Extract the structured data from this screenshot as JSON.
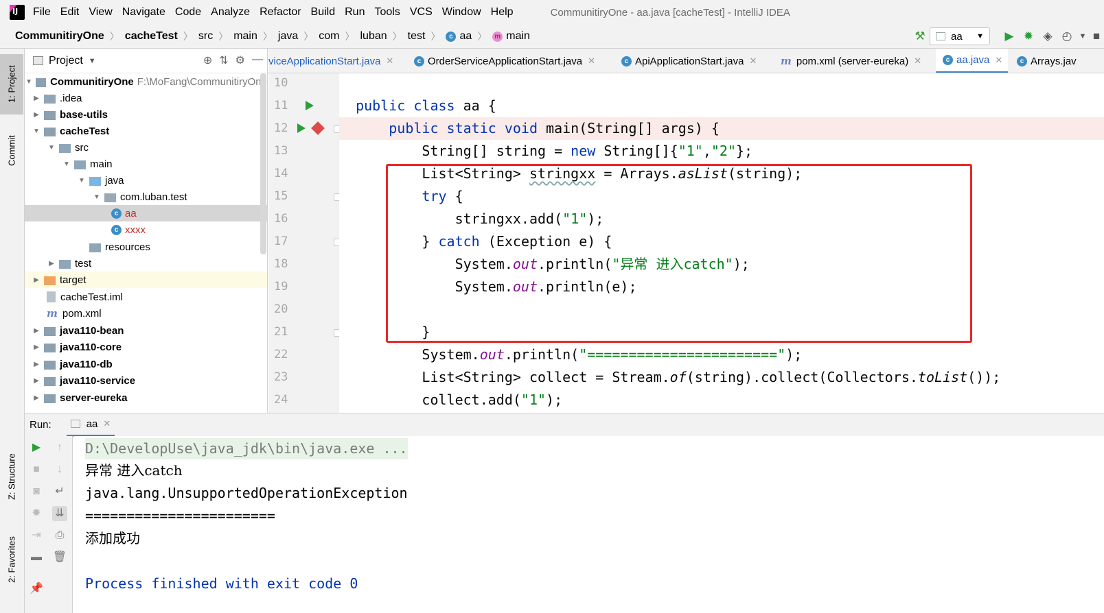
{
  "menubar": {
    "items": [
      "File",
      "Edit",
      "View",
      "Navigate",
      "Code",
      "Analyze",
      "Refactor",
      "Build",
      "Run",
      "Tools",
      "VCS",
      "Window",
      "Help"
    ],
    "title": "CommunitiryOne - aa.java [cacheTest] - IntelliJ IDEA"
  },
  "breadcrumb": {
    "items": [
      "CommunitiryOne",
      "cacheTest",
      "src",
      "main",
      "java",
      "com",
      "luban",
      "test",
      "aa",
      "main"
    ],
    "run_config": "aa"
  },
  "sidebar": {
    "project_tab": "1: Project",
    "commit_tab": "Commit",
    "structure_tab": "Z: Structure",
    "favorites_tab": "2: Favorites"
  },
  "project": {
    "header": "Project",
    "root_name": "CommunitiryOne",
    "root_path": "F:\\MoFang\\CommunitiryOne",
    "tree": [
      ".idea",
      "base-utils",
      "cacheTest",
      "src",
      "main",
      "java",
      "com.luban.test",
      "aa",
      "xxxx",
      "resources",
      "test",
      "target",
      "cacheTest.iml",
      "pom.xml",
      "java110-bean",
      "java110-core",
      "java110-db",
      "java110-service",
      "server-eureka"
    ]
  },
  "editor": {
    "tabs": [
      "viceApplicationStart.java",
      "OrderServiceApplicationStart.java",
      "ApiApplicationStart.java",
      "pom.xml (server-eureka)",
      "aa.java",
      "Arrays.jav"
    ],
    "line_numbers": [
      "10",
      "11",
      "12",
      "13",
      "14",
      "15",
      "16",
      "17",
      "18",
      "19",
      "20",
      "21",
      "22",
      "23",
      "24"
    ],
    "code": {
      "l11_kw": "public class ",
      "l11_rest": "aa {",
      "l12_ind": "    ",
      "l12_kw": "public static void ",
      "l12_rest": "main(String[] args) {",
      "l13_a": "        String[] string = ",
      "l13_kw": "new ",
      "l13_b": "String[]{",
      "l13_s1": "\"1\"",
      "l13_c": ",",
      "l13_s2": "\"2\"",
      "l13_d": "};",
      "l14_a": "        List<String> ",
      "l14_var": "stringxx",
      "l14_b": " = Arrays.",
      "l14_m": "asList",
      "l14_c": "(string);",
      "l15_ind": "        ",
      "l15_kw": "try",
      "l15_rest": " {",
      "l16_a": "            stringxx.add(",
      "l16_s": "\"1\"",
      "l16_b": ");",
      "l17_a": "        } ",
      "l17_kw": "catch",
      "l17_b": " (Exception e) {",
      "l18_a": "            System.",
      "l18_f": "out",
      "l18_b": ".println(",
      "l18_s": "\"异常 进入catch\"",
      "l18_c": ");",
      "l19_a": "            System.",
      "l19_f": "out",
      "l19_b": ".println(e);",
      "l21": "        }",
      "l22_a": "        System.",
      "l22_f": "out",
      "l22_b": ".println(",
      "l22_s": "\"=======================\"",
      "l22_c": ");",
      "l23_a": "        List<String> collect = Stream.",
      "l23_m1": "of",
      "l23_b": "(string).collect(Collectors.",
      "l23_m2": "toList",
      "l23_c": "());",
      "l24_a": "        collect.add(",
      "l24_s": "\"1\"",
      "l24_b": ");"
    }
  },
  "run": {
    "label": "Run:",
    "tab": "aa",
    "console": [
      "D:\\DevelopUse\\java_jdk\\bin\\java.exe ...",
      "异常 进入catch",
      "java.lang.UnsupportedOperationException",
      "=======================",
      "添加成功",
      "",
      "Process finished with exit code 0"
    ]
  },
  "colors": {
    "accent": "#4083c9",
    "keyword": "#0033b3",
    "string": "#067d17",
    "highlight_box": "#e8272a"
  }
}
